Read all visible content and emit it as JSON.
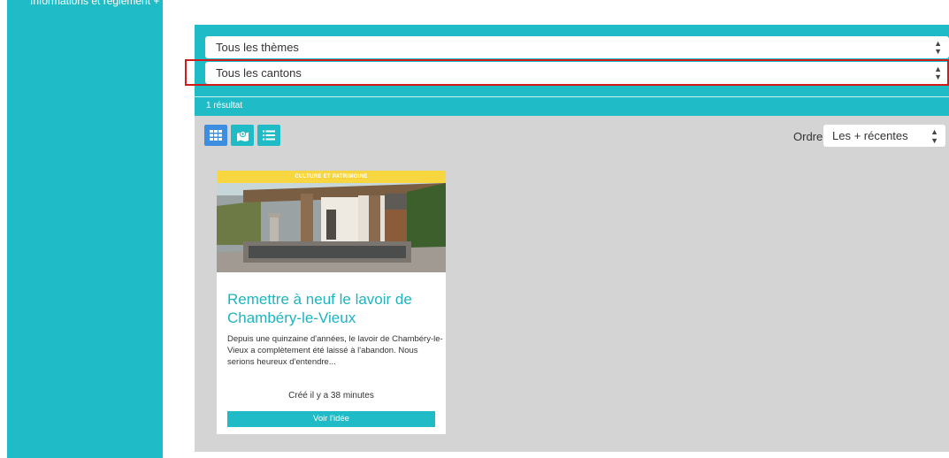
{
  "sidebar": {
    "link_label": "Informations et règlement +"
  },
  "filters": {
    "theme_select": "Tous les thèmes",
    "canton_select": "Tous les cantons",
    "result_count": "1 résultat"
  },
  "toolbar": {
    "view_buttons": [
      "grid-icon",
      "map-icon",
      "list-icon"
    ],
    "active_view": "grid",
    "order_label": "Ordre",
    "order_value": "Les + récentes"
  },
  "cards": [
    {
      "tag": "CULTURE ET PATRIMOINE",
      "title": "Remettre à neuf le lavoir de Chambéry-le-Vieux",
      "description": "Depuis une quinzaine d'années, le lavoir de Chambéry-le-Vieux a complètement été laissé à l'abandon. Nous serions heureux d'entendre...",
      "created": "Créé il y a 38 minutes",
      "button_label": "Voir l'idée"
    }
  ],
  "colors": {
    "brand": "#1fbcc7",
    "active": "#3d8ee0",
    "tag": "#f7d640",
    "highlight": "#d21b1b",
    "content_bg": "#d4d4d4"
  }
}
